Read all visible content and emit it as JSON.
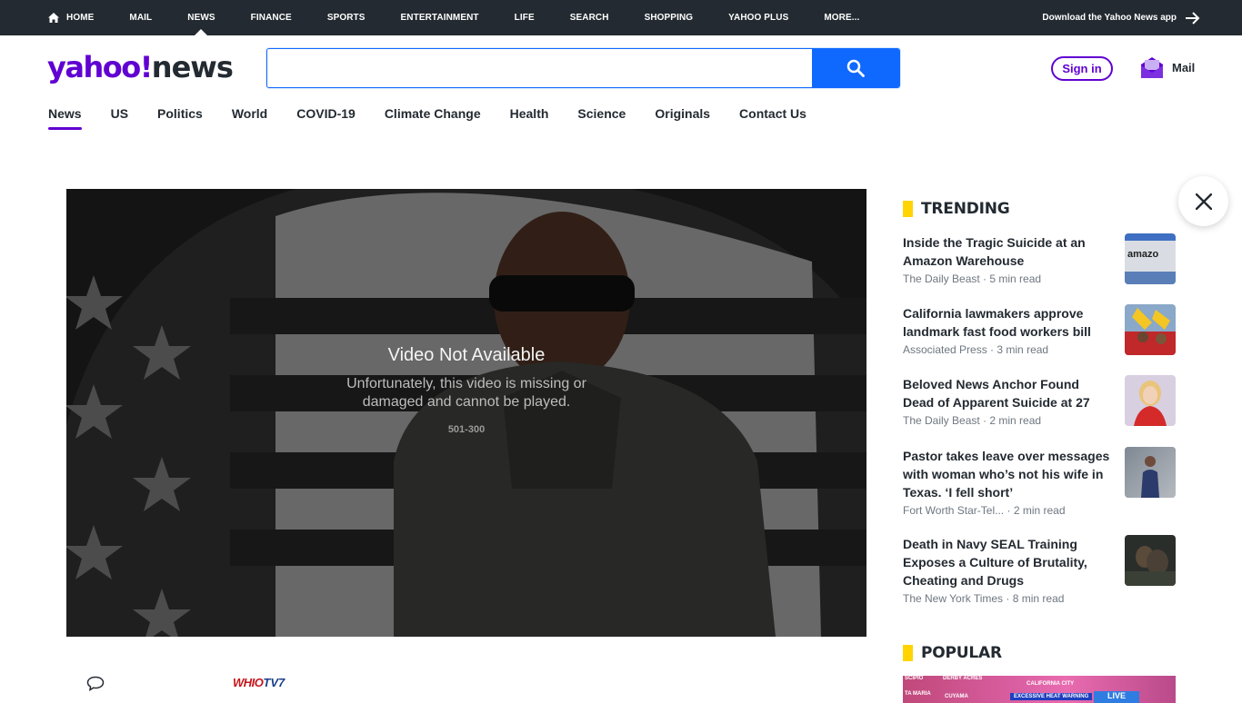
{
  "topnav": {
    "items": [
      {
        "label": "HOME",
        "icon": "home-icon"
      },
      {
        "label": "MAIL"
      },
      {
        "label": "NEWS",
        "active": true
      },
      {
        "label": "FINANCE"
      },
      {
        "label": "SPORTS"
      },
      {
        "label": "ENTERTAINMENT"
      },
      {
        "label": "LIFE"
      },
      {
        "label": "SEARCH"
      },
      {
        "label": "SHOPPING"
      },
      {
        "label": "YAHOO PLUS"
      },
      {
        "label": "MORE..."
      }
    ],
    "download_label": "Download the Yahoo News app"
  },
  "header": {
    "logo_yahoo": "yahoo!",
    "logo_news": "news",
    "search_placeholder": "",
    "signin_label": "Sign in",
    "mail_label": "Mail"
  },
  "secnav": {
    "items": [
      "News",
      "US",
      "Politics",
      "World",
      "COVID-19",
      "Climate Change",
      "Health",
      "Science",
      "Originals",
      "Contact Us"
    ],
    "active_index": 0
  },
  "video": {
    "title": "Video Not Available",
    "message": "Unfortunately, this video is missing or damaged and cannot be played.",
    "code": "501-300"
  },
  "trending": {
    "heading": "TRENDING",
    "stories": [
      {
        "title": "Inside the Tragic Suicide at an Amazon Warehouse",
        "source": "The Daily Beast",
        "read": "5 min read"
      },
      {
        "title": "California lawmakers approve landmark fast food workers bill",
        "source": "Associated Press",
        "read": "3 min read"
      },
      {
        "title": "Beloved News Anchor Found Dead of Apparent Suicide at 27",
        "source": "The Daily Beast",
        "read": "2 min read"
      },
      {
        "title": "Pastor takes leave over messages with woman who’s not his wife in Texas. ‘I fell short’",
        "source": "Fort Worth Star-Tel...",
        "read": "2 min read"
      },
      {
        "title": "Death in Navy SEAL Training Exposes a Culture of Brutality, Cheating and Drugs",
        "source": "The New York Times",
        "read": "8 min read"
      }
    ]
  },
  "popular": {
    "heading": "POPULAR",
    "map_labels": [
      "SCIPIO",
      "DERBY ACRES",
      "CALIFORNIA CITY",
      "TA MARIA",
      "CUYAMA"
    ],
    "warning": "EXCESSIVE HEAT WARNING",
    "live": "LIVE"
  },
  "footer": {
    "source_logo_w": "WHIO",
    "source_logo_tv": "TV7"
  },
  "colors": {
    "brand_purple": "#6001d2",
    "search_blue": "#0f69ff",
    "topbar": "#232a31",
    "trending_yellow": "#ffd400"
  }
}
